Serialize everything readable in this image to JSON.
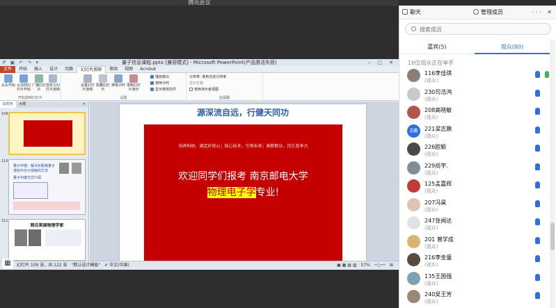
{
  "meeting": {
    "title": "腾讯会议"
  },
  "ppt": {
    "doc_title": "量子信息课程.pptx [兼容模式] - Microsoft PowerPoint(产品激活失败)",
    "tabs": [
      "文件",
      "开始",
      "插入",
      "设计",
      "切换",
      "幻灯片放映",
      "审阅",
      "视图",
      "Acrobat"
    ],
    "active_tab": "幻灯片放映",
    "ribbon": {
      "buttons": [
        "从头开始",
        "从当前幻灯片开始",
        "广播幻灯片",
        "自定义幻灯片放映",
        "设置幻灯片放映",
        "隐藏幻灯片",
        "排练计时",
        "录制幻灯片演示"
      ],
      "checks": [
        "播放旁白",
        "使用计时",
        "显示媒体控件"
      ],
      "checks_on": [
        true,
        true,
        true
      ],
      "resolution_label": "分辨率:",
      "resolution_value": "使用当前分辨率",
      "show_on_label": "显示位置",
      "presenter_view": "使用演示者视图",
      "groups": [
        "开始放映幻灯片",
        "设置",
        "监视器"
      ]
    },
    "thumb_tabs": [
      "幻灯片",
      "大纲"
    ],
    "thumbs": [
      {
        "num": "109"
      },
      {
        "num": "110",
        "text": "量子中继：解决长距离量子通信中光子损耗的方法",
        "sub": "量子中继方式介绍"
      },
      {
        "num": "111",
        "text": "两位美国物理学家"
      }
    ],
    "slide": {
      "title": "源深流自远，行健天同功",
      "small_text": "培养科研、满足好奇心；核心技术，引领未来；高薪职业，持久竞争力",
      "big_line1": "欢迎同学们报考   南京邮电大学",
      "big_line2_highlight": "物理电子学",
      "big_line2_rest": "专业!"
    },
    "status": {
      "slide_info": "幻灯片 109 张，共 122 张",
      "theme": "\"默认设计模板\"",
      "lang": "中文(中国)",
      "zoom": "57%"
    }
  },
  "panel": {
    "tab_chat": "聊天",
    "tab_members": "管理成员",
    "search_placeholder": "搜索成员",
    "guests_tab": "嘉宾(5)",
    "audience_tab": "观众(80)",
    "hands_up": "16位观众正在举手",
    "members": [
      {
        "name": "116李佳琪",
        "role": "(观众)",
        "color": "#8a7f78",
        "hands": 2
      },
      {
        "name": "230司浩鸿",
        "role": "(观众)",
        "color": "#c9c9c9",
        "hands": 1
      },
      {
        "name": "208高晓敏",
        "role": "(观众)",
        "color": "#b5534d",
        "hands": 1
      },
      {
        "name": "221梁志鹏",
        "role": "(观众)",
        "color": "#2f6fe0",
        "hands": 1,
        "initials": "志鹏"
      },
      {
        "name": "226欧颖",
        "role": "(观众)",
        "color": "#4a4a4a",
        "hands": 1
      },
      {
        "name": "229尚宇.",
        "role": "(观众)",
        "color": "#7e8d96",
        "hands": 1
      },
      {
        "name": "125孟嘉辉",
        "role": "(观众)",
        "color": "#c23b3b",
        "hands": 1
      },
      {
        "name": "207冯昊",
        "role": "(观众)",
        "color": "#d9c6b5",
        "hands": 1
      },
      {
        "name": "247张闻达",
        "role": "(观众)",
        "color": "#e2e2e2",
        "hands": 1
      },
      {
        "name": "201 曾学成",
        "role": "(观众)",
        "color": "#d8b56a",
        "hands": 1
      },
      {
        "name": "216李金童",
        "role": "(观众)",
        "color": "#5a4b3f",
        "hands": 1
      },
      {
        "name": "135王国强",
        "role": "(观众)",
        "color": "#7fa0b5",
        "hands": 1
      },
      {
        "name": "240吴王芳",
        "role": "(观众)",
        "color": "#9a8877",
        "hands": 1
      }
    ]
  }
}
